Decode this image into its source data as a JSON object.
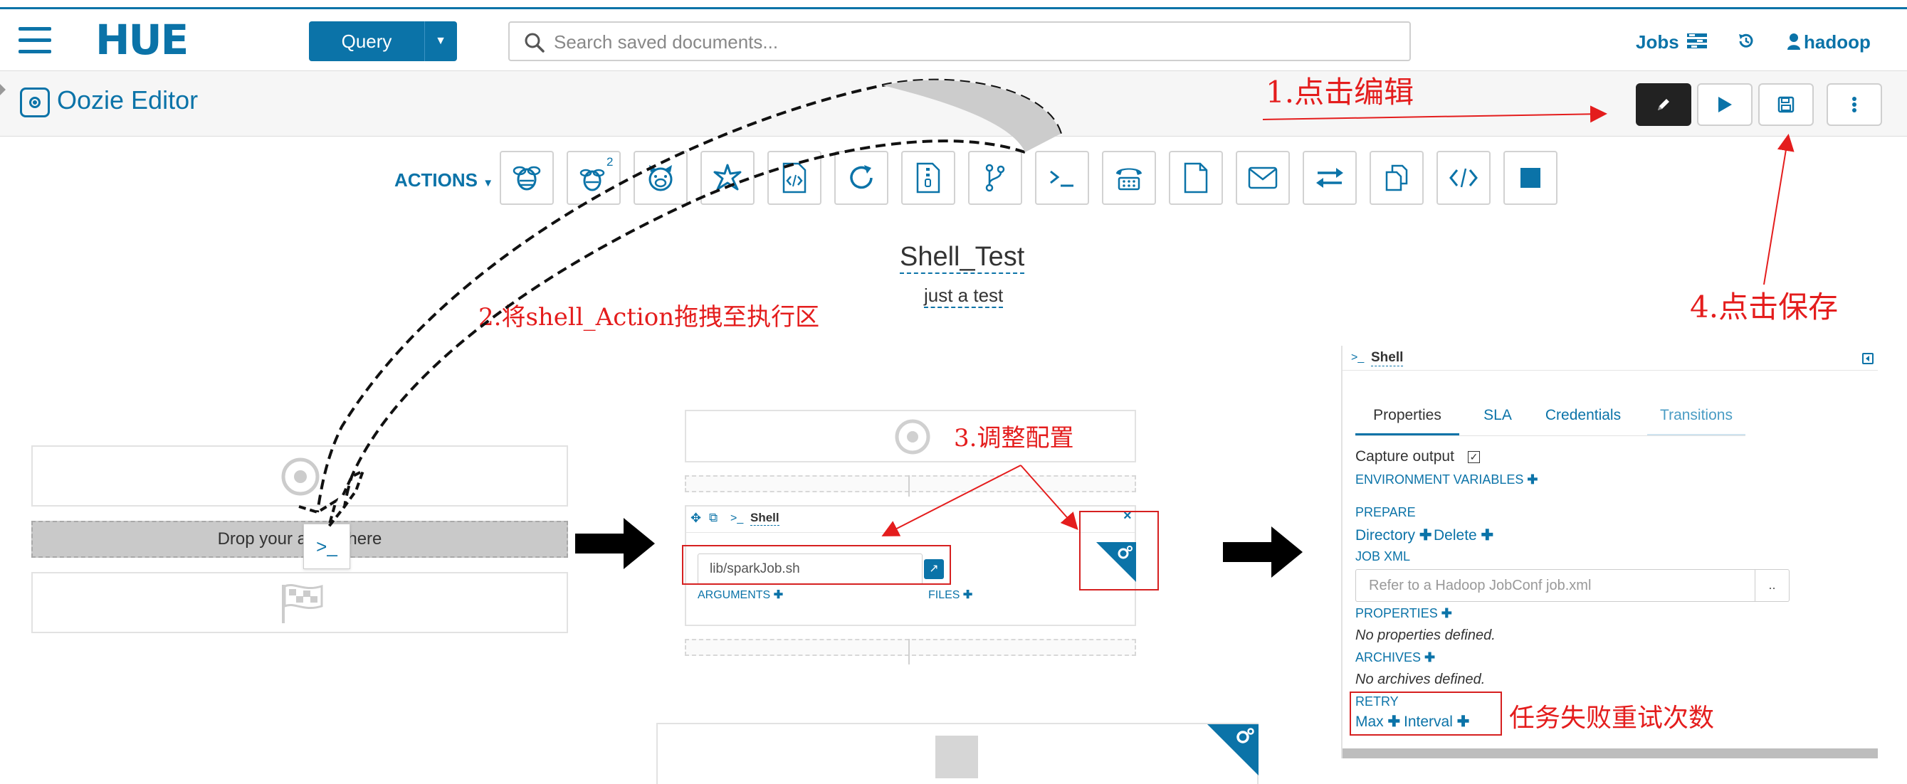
{
  "navbar": {
    "logo": "HUE",
    "query_label": "Query",
    "search_placeholder": "Search saved documents...",
    "jobs_label": "Jobs",
    "user_label": "hadoop"
  },
  "editor": {
    "title": "Oozie Editor"
  },
  "actions": {
    "label": "ACTIONS",
    "hive2_superscript": "2"
  },
  "workflow": {
    "name": "Shell_Test",
    "description": "just a test"
  },
  "canvas_left": {
    "drop_text": "Drop your action here",
    "shell_chip": ">_"
  },
  "canvas_mid": {
    "node_title": "Shell",
    "command_value": "lib/sparkJob.sh",
    "arguments_label": "ARGUMENTS",
    "files_label": "FILES"
  },
  "panel": {
    "header": "Shell",
    "tabs": [
      "Properties",
      "SLA",
      "Credentials",
      "Transitions"
    ],
    "capture_output": "Capture output",
    "env_vars": "ENVIRONMENT VARIABLES",
    "prepare": "PREPARE",
    "directory": "Directory",
    "delete": "Delete",
    "job_xml": "JOB XML",
    "job_xml_placeholder": "Refer to a Hadoop JobConf job.xml",
    "browse": "..",
    "properties": "PROPERTIES",
    "no_properties": "No properties defined.",
    "archives": "ARCHIVES",
    "no_archives": "No archives defined.",
    "retry": "RETRY",
    "max": "Max",
    "interval": "Interval"
  },
  "annotations": {
    "step1": "1.点击编辑",
    "step2": "2.将shell_Action拖拽至执行区",
    "step3": "3.调整配置",
    "step4": "4.点击保存",
    "retry_note": "任务失败重试次数"
  },
  "colors": {
    "brand": "#0b73a8",
    "annotation": "#e41d1d"
  }
}
